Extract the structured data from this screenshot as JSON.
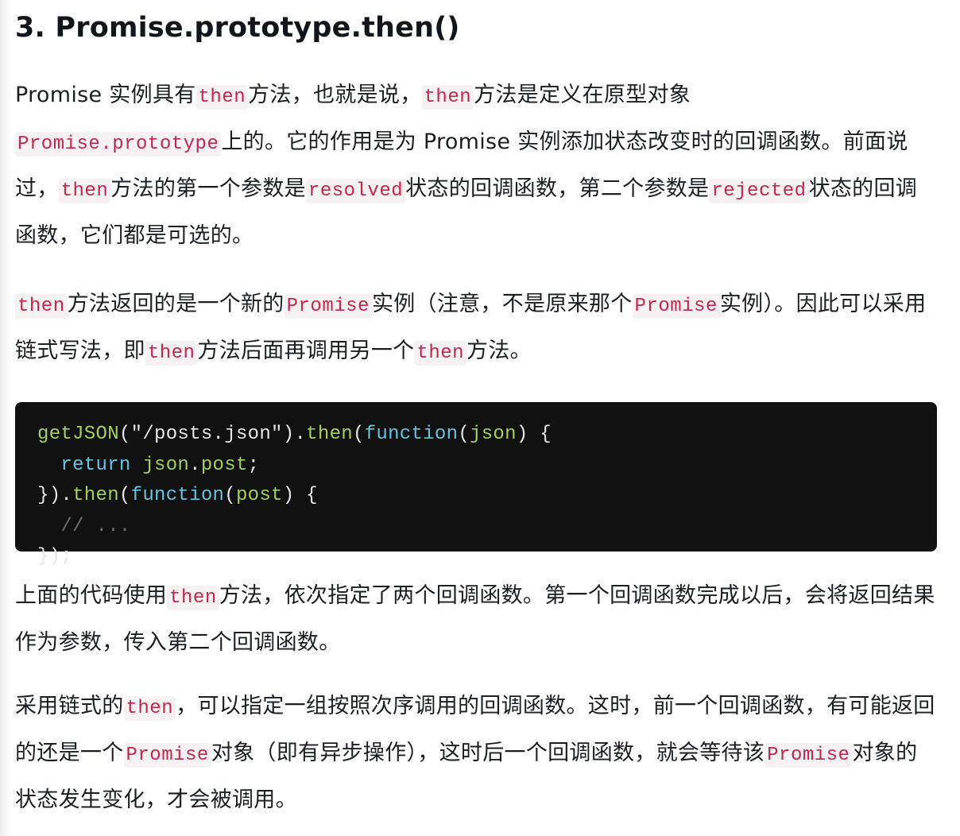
{
  "heading": "3. Promise.prototype.then()",
  "paragraphs": {
    "p1": {
      "t1": "Promise 实例具有",
      "c1": "then",
      "t2": "方法，也就是说，",
      "c2": "then",
      "t3": "方法是定义在原型对象",
      "c3": "Promise.prototype",
      "t4": "上的。它的作用是为 Promise 实例添加状态改变时的回调函数。前面说过，",
      "c4": "then",
      "t5": "方法的第一个参数是",
      "c5": "resolved",
      "t6": "状态的回调函数，第二个参数是",
      "c6": "rejected",
      "t7": "状态的回调函数，它们都是可选的。"
    },
    "p2": {
      "c1": "then",
      "t1": "方法返回的是一个新的",
      "c2": "Promise",
      "t2": "实例（注意，不是原来那个",
      "c3": "Promise",
      "t3": "实例）。因此可以采用链式写法，即",
      "c4": "then",
      "t4": "方法后面再调用另一个",
      "c5": "then",
      "t5": "方法。"
    },
    "p3": {
      "t1": "上面的代码使用",
      "c1": "then",
      "t2": "方法，依次指定了两个回调函数。第一个回调函数完成以后，会将返回结果作为参数，传入第二个回调函数。"
    },
    "p4": {
      "t1": "采用链式的",
      "c1": "then",
      "t2": "，可以指定一组按照次序调用的回调函数。这时，前一个回调函数，有可能返回的还是一个",
      "c2": "Promise",
      "t3": "对象（即有异步操作），这时后一个回调函数，就会等待该",
      "c3": "Promise",
      "t4": "对象的状态发生变化，才会被调用。"
    }
  },
  "code": {
    "language": "javascript",
    "lines": [
      [
        {
          "t": "getJSON",
          "k": "fn"
        },
        {
          "t": "(",
          "k": "pun"
        },
        {
          "t": "\"/posts.json\"",
          "k": "str"
        },
        {
          "t": ")",
          "k": "pun"
        },
        {
          "t": ".",
          "k": "pun"
        },
        {
          "t": "then",
          "k": "fn"
        },
        {
          "t": "(",
          "k": "pun"
        },
        {
          "t": "function",
          "k": "kw"
        },
        {
          "t": "(",
          "k": "pun"
        },
        {
          "t": "json",
          "k": "id"
        },
        {
          "t": ")",
          "k": "pun"
        },
        {
          "t": " {",
          "k": "pun"
        }
      ],
      [
        {
          "t": "  ",
          "k": "pun"
        },
        {
          "t": "return",
          "k": "kw"
        },
        {
          "t": " ",
          "k": "pun"
        },
        {
          "t": "json",
          "k": "id"
        },
        {
          "t": ".",
          "k": "pun"
        },
        {
          "t": "post",
          "k": "id"
        },
        {
          "t": ";",
          "k": "pun"
        }
      ],
      [
        {
          "t": "})",
          "k": "pun"
        },
        {
          "t": ".",
          "k": "pun"
        },
        {
          "t": "then",
          "k": "fn"
        },
        {
          "t": "(",
          "k": "pun"
        },
        {
          "t": "function",
          "k": "kw"
        },
        {
          "t": "(",
          "k": "pun"
        },
        {
          "t": "post",
          "k": "id"
        },
        {
          "t": ")",
          "k": "pun"
        },
        {
          "t": " {",
          "k": "pun"
        }
      ],
      [
        {
          "t": "  ",
          "k": "pun"
        },
        {
          "t": "// ...",
          "k": "com"
        }
      ],
      [
        {
          "t": "});",
          "k": "pun"
        }
      ]
    ]
  },
  "colors": {
    "inline_code": "#c7254e",
    "inline_code_bg": "#f6f1f2",
    "code_bg": "#111111",
    "code_fn": "#a4d05a",
    "code_kw": "#66c3dd",
    "code_comment": "#6d6d6d",
    "text": "#1b1f23"
  }
}
